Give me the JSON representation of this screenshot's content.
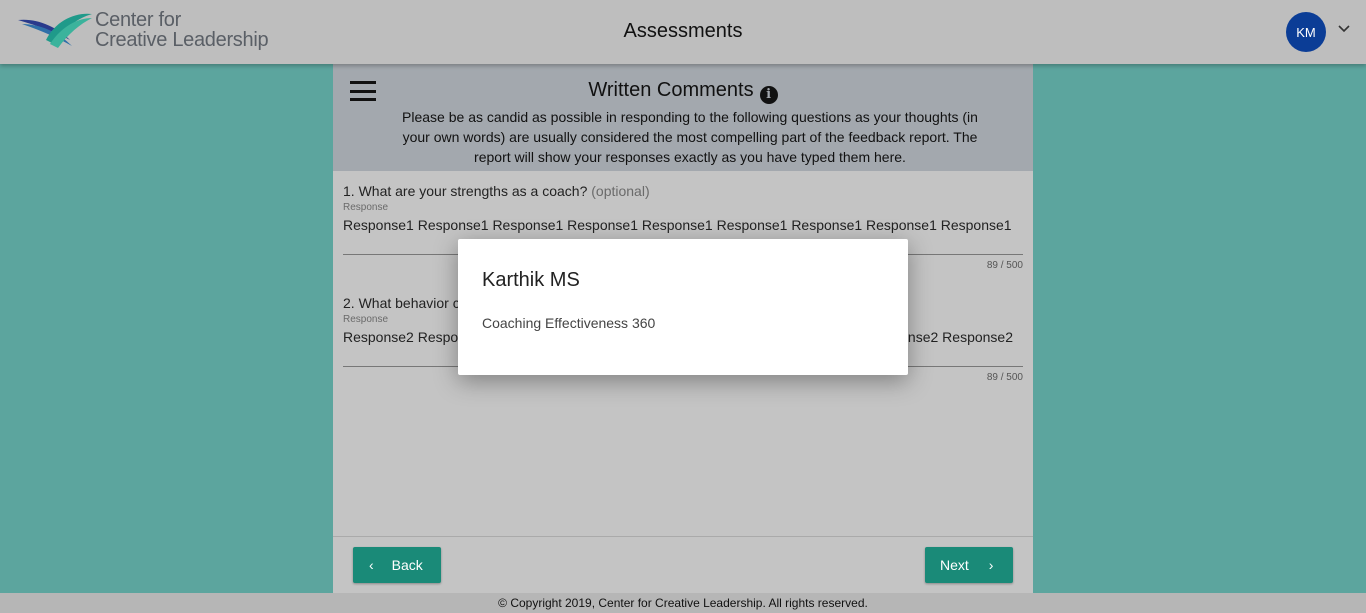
{
  "header": {
    "logo_line1": "Center for",
    "logo_line2": "Creative Leadership",
    "title": "Assessments",
    "avatar_initials": "KM"
  },
  "section": {
    "title": "Written Comments",
    "intro": "Please be as candid as possible in responding to the following questions as your thoughts (in your own words) are usually considered the most compelling part of the feedback report. The report will show your responses exactly as you have typed them here."
  },
  "questions": [
    {
      "label": "1. What are your strengths as a coach?",
      "optional": "(optional)",
      "response_label": "Response",
      "response_words": [
        "Response1",
        "Response1",
        "Response1",
        "Response1",
        "Response1",
        "Response1",
        "Response1",
        "Response1",
        "Response1"
      ],
      "counter": "89 / 500"
    },
    {
      "label": "2. What behavior c",
      "response_label": "Response",
      "response_visible_left": "Response2 Respo",
      "response_visible_right": "nse2 Response2",
      "counter": "89 / 500"
    }
  ],
  "nav": {
    "back": "Back",
    "next": "Next"
  },
  "footer": {
    "copyright": "© Copyright 2019, Center for Creative Leadership. All rights reserved."
  },
  "dialog": {
    "name": "Karthik MS",
    "assessment": "Coaching Effectiveness 360"
  },
  "colors": {
    "background": "#5ca59e",
    "header": "#bebebe",
    "intro_bg": "#a3a8ae",
    "button": "#1a8a78",
    "avatar": "#0b3d96"
  }
}
